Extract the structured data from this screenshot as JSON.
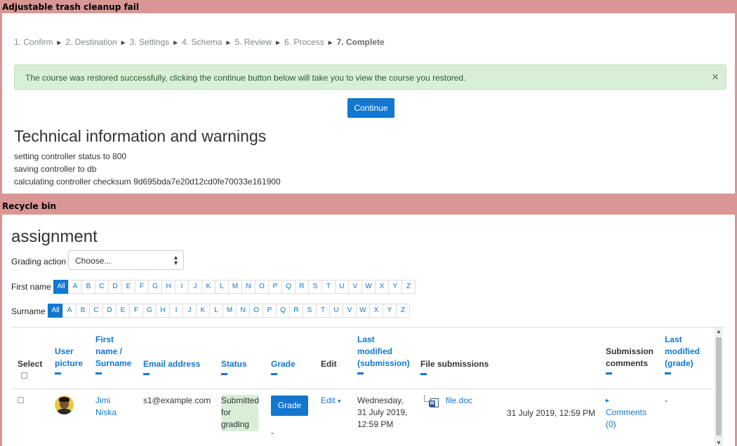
{
  "section1": {
    "label": "Adjustable trash cleanup fail",
    "steps": [
      "1. Confirm",
      "2. Destination",
      "3. Settings",
      "4. Schema",
      "5. Review",
      "6. Process"
    ],
    "current_step": "7. Complete",
    "arrow": "►",
    "alert_message": "The course was restored successfully, clicking the continue button below will take you to view the course you restored.",
    "alert_close": "×",
    "continue_label": "Continue",
    "tech_title": "Technical information and warnings",
    "tech_lines": [
      "setting controller status to 800",
      "saving controller to db",
      "calculating controller checksum 9d695bda7e20d12cd0fe70033e161900"
    ]
  },
  "section2": {
    "label": "Recycle bin",
    "title": "assignment",
    "grading_action_label": "Grading action",
    "grading_select_value": "Choose...",
    "first_name_label": "First name",
    "surname_label": "Surname",
    "letters": [
      "All",
      "A",
      "B",
      "C",
      "D",
      "E",
      "F",
      "G",
      "H",
      "I",
      "J",
      "K",
      "L",
      "M",
      "N",
      "O",
      "P",
      "Q",
      "R",
      "S",
      "T",
      "U",
      "V",
      "W",
      "X",
      "Y",
      "Z"
    ],
    "headers": {
      "select": "Select",
      "user_picture": [
        "User",
        "picture"
      ],
      "first_name_surname": [
        "First",
        "name /",
        "Surname"
      ],
      "email": "Email address",
      "status": "Status",
      "grade": "Grade",
      "edit": "Edit",
      "last_modified_submission": [
        "Last",
        "modified",
        "(submission)"
      ],
      "file_submissions": "File submissions",
      "submission_comments": [
        "Submission",
        "comments"
      ],
      "last_modified_grade": [
        "Last",
        "modified",
        "(grade)"
      ]
    },
    "row": {
      "first_name": "Jimi",
      "surname": "Niska",
      "email": "s1@example.com",
      "status": [
        "Submitted",
        "for",
        "grading"
      ],
      "grade_button": "Grade",
      "grade_value": "-",
      "edit_label": "Edit",
      "edit_caret": "▾",
      "modified": [
        "Wednesday,",
        "31 July 2019,",
        "12:59 PM"
      ],
      "file_name": "file.doc",
      "file_date": "31 July 2019, 12:59 PM",
      "comments_arrow": "▸",
      "comments": [
        "Comments",
        "(0)"
      ],
      "last_modified_grade": "-"
    },
    "colors": {
      "accent": "#1177d1",
      "success_bg": "#d8eed7",
      "frame": "#d99694"
    },
    "icons": {
      "file": "word-document-icon",
      "close": "close-icon"
    }
  }
}
